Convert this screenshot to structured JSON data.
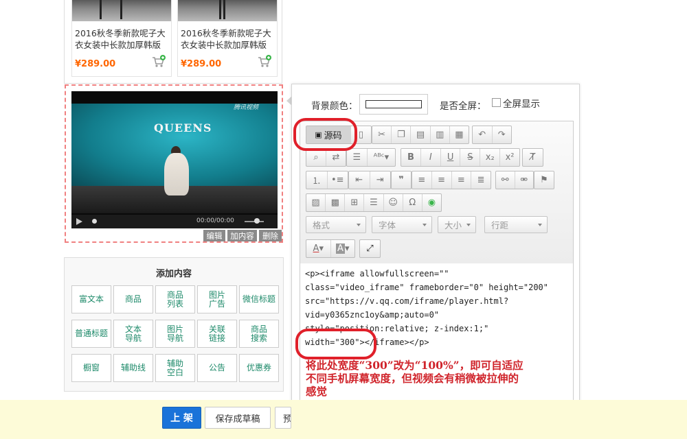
{
  "products": [
    {
      "title": "2016秋冬季新款呢子大衣女装中长款加厚韩版",
      "price": "¥289.00"
    },
    {
      "title": "2016秋冬季新款呢子大衣女装中长款加厚韩版",
      "price": "¥289.00"
    }
  ],
  "video": {
    "brand_text": "QUEENS",
    "watermark": "腾讯视频",
    "time": "00:00/00:00",
    "actions": [
      "编辑",
      "加内容",
      "删除"
    ]
  },
  "add_panel": {
    "title": "添加内容",
    "buttons": [
      [
        "富文本"
      ],
      [
        "商品"
      ],
      [
        "商品",
        "列表"
      ],
      [
        "图片",
        "广告"
      ],
      [
        "微信标题"
      ],
      [
        "普通标题"
      ],
      [
        "文本",
        "导航"
      ],
      [
        "图片",
        "导航"
      ],
      [
        "关联",
        "链接"
      ],
      [
        "商品",
        "搜索"
      ],
      [
        "橱窗"
      ],
      [
        "辅助线"
      ],
      [
        "辅助",
        "空白"
      ],
      [
        "公告"
      ],
      [
        "优惠券"
      ]
    ]
  },
  "editor": {
    "bg_color_label": "背景颜色：",
    "fullscreen_label": "是否全屏：",
    "fullscreen_option": "全屏显示",
    "source_button": "源码",
    "dropdowns": [
      "格式",
      "字体",
      "大小",
      "行距"
    ],
    "code_lines": [
      "<p><iframe allowfullscreen=\"\"",
      "class=\"video_iframe\" frameborder=\"0\" height=\"200\"",
      "src=\"https://v.qq.com/iframe/player.html?",
      "vid=y0365znc1oy&amp;auto=0\"",
      "style=\"position:relative; z-index:1;\"",
      "width=\"300\"></iframe></p>"
    ],
    "annotation_lines": [
      "将此处宽度“300”改为“100%”，即可自适应",
      "不同手机屏幕宽度，但视频会有稍微被拉伸的",
      "感觉"
    ],
    "highlight_color": "#e0202a"
  },
  "bottom_bar": {
    "publish": "上 架",
    "save_draft": "保存成草稿",
    "preview": "预"
  }
}
